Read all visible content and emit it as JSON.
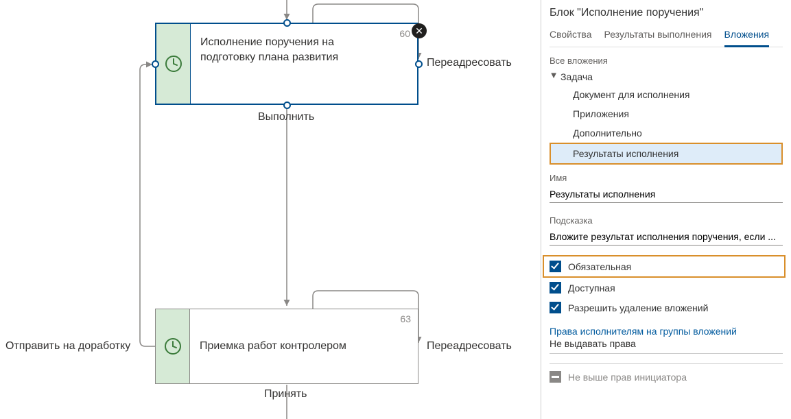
{
  "canvas": {
    "block1": {
      "num": "60",
      "titleLine1": "Исполнение поручения на",
      "titleLine2": "подготовку плана развития"
    },
    "block2": {
      "num": "63",
      "title": "Приемка работ контролером"
    },
    "edgeLabels": {
      "block1_right": "Переадресовать",
      "block1_bottom": "Выполнить",
      "block2_left": "Отправить на доработку",
      "block2_right": "Переадресовать",
      "block2_bottom": "Принять"
    }
  },
  "panel": {
    "title": "Блок \"Исполнение поручения\"",
    "tabs": {
      "properties": "Свойства",
      "results": "Результаты выполнения",
      "attachments": "Вложения"
    },
    "allAttachmentsLabel": "Все вложения",
    "tree": {
      "groupLabel": "Задача",
      "items": {
        "doc": "Документ для исполнения",
        "apps": "Приложения",
        "extra": "Дополнительно",
        "results": "Результаты исполнения"
      }
    },
    "nameLabel": "Имя",
    "nameValue": "Результаты исполнения",
    "hintLabel": "Подсказка",
    "hintValue": "Вложите результат исполнения поручения, если ...",
    "checks": {
      "required": "Обязательная",
      "available": "Доступная",
      "allowDelete": "Разрешить удаление вложений"
    },
    "permissionsLink": "Права исполнителям на группы вложений",
    "permissionsValue": "Не выдавать права",
    "notAboveInitiator": "Не выше прав инициатора"
  }
}
